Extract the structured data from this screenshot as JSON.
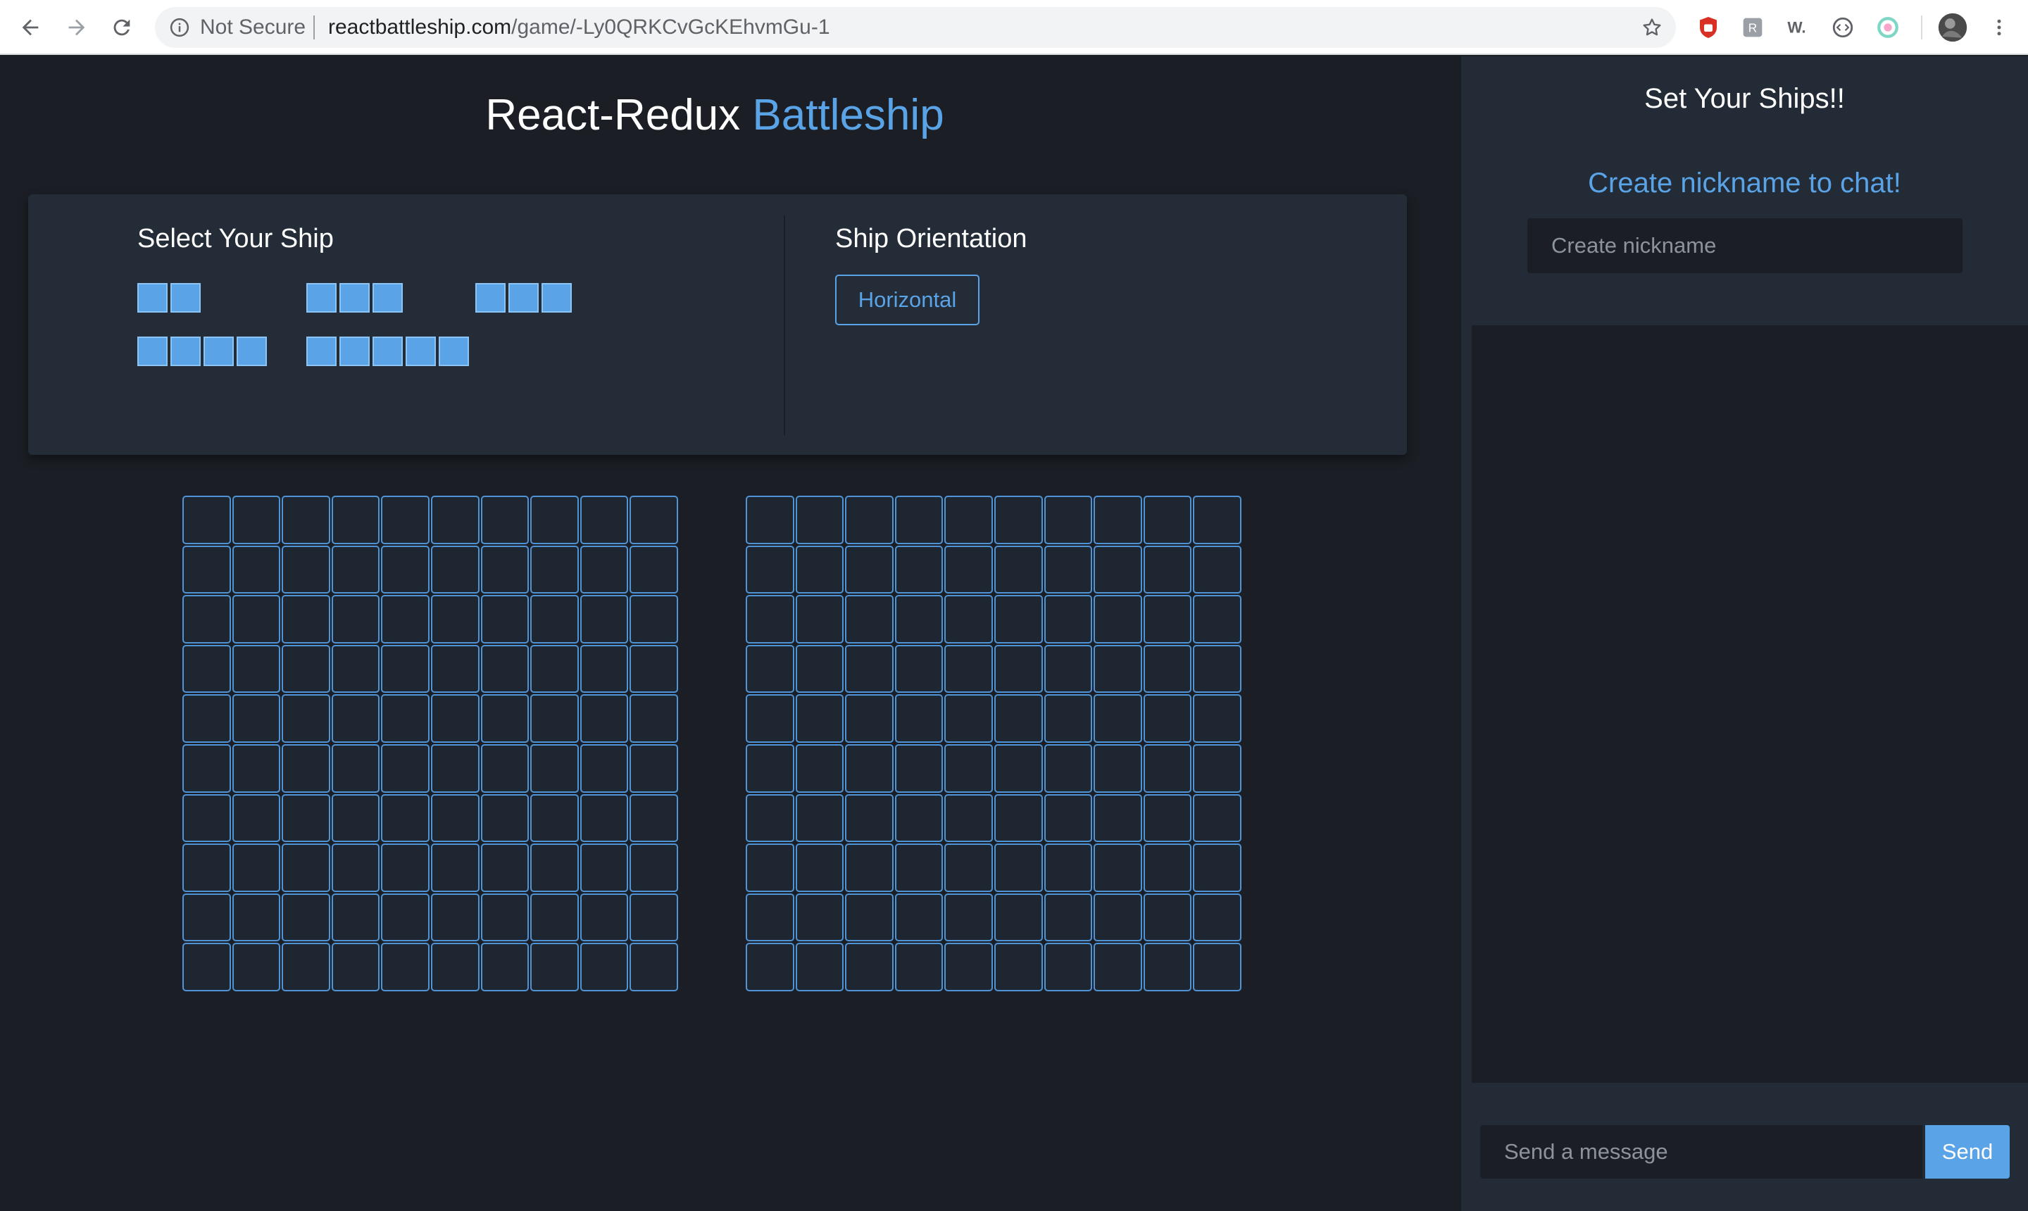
{
  "browser": {
    "security_label": "Not Secure",
    "url_host": "reactbattleship.com",
    "url_path": "/game/-Ly0QRKCvGcKEhvmGu-1",
    "extensions": [
      "ublock-icon",
      "extension-r-icon",
      "w-extension-icon",
      "code-extension-icon",
      "color-extension-icon"
    ],
    "accent_color": "#d93025"
  },
  "header": {
    "title_main": "React-Redux",
    "title_accent": "Battleship"
  },
  "ship_panel": {
    "select_title": "Select Your Ship",
    "ships": [
      {
        "name": "ship-2",
        "size": 2
      },
      {
        "name": "ship-3a",
        "size": 3
      },
      {
        "name": "ship-3b",
        "size": 3
      },
      {
        "name": "ship-4",
        "size": 4
      },
      {
        "name": "ship-5",
        "size": 5
      }
    ],
    "orientation_title": "Ship Orientation",
    "orientation_value": "Horizontal"
  },
  "boards": {
    "rows": 10,
    "cols": 10,
    "count": 2
  },
  "sidebar": {
    "title": "Set Your Ships!!",
    "nickname_prompt": "Create nickname to chat!",
    "nickname_placeholder": "Create nickname",
    "message_placeholder": "Send a message",
    "send_label": "Send"
  },
  "colors": {
    "accent": "#5aa3e6",
    "background": "#1b1f25",
    "panel": "#232c37"
  }
}
